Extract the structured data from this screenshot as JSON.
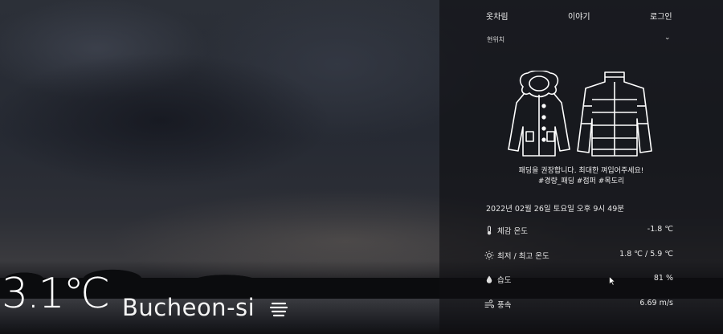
{
  "nav": {
    "item1": "옷차림",
    "item2": "이야기",
    "item3": "로그인"
  },
  "location": {
    "selected": "현위치",
    "chevron": "chevron-down-icon"
  },
  "recommendation": {
    "line1": "패딩을 권장합니다. 최대한 껴입어주세요!",
    "line2": "#경량_패딩 #점퍼 #목도리",
    "icons": [
      "fur-hood-coat-icon",
      "puffer-jacket-icon"
    ]
  },
  "datetime": "2022년 02월 26일 토요일 오후 9시 49분",
  "weather": {
    "feels_like": {
      "label": "체감 온도",
      "value": "-1.8 ℃",
      "icon": "thermometer-icon"
    },
    "min_max": {
      "label": "최저 / 최고 온도",
      "value": "1.8 ℃ / 5.9 ℃",
      "icon": "sun-icon"
    },
    "humidity": {
      "label": "습도",
      "value": "81 %",
      "icon": "droplet-icon"
    },
    "wind": {
      "label": "풍속",
      "value": "6.69 m/s",
      "icon": "wind-icon"
    }
  },
  "current": {
    "temperature": "3.1℃",
    "city": "Bucheon-si",
    "condition_icon": "fog-icon"
  },
  "colors": {
    "text": "#ffffff",
    "panel": "rgba(14,15,18,0.62)",
    "sky": "#2c3038"
  }
}
